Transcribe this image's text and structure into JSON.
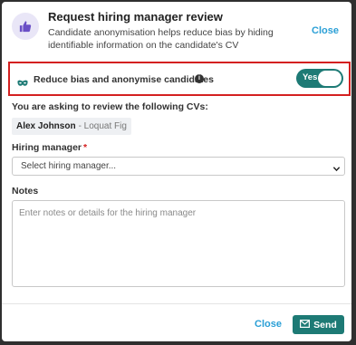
{
  "header": {
    "title": "Request hiring manager review",
    "subtitle": "Candidate anonymisation helps reduce bias by hiding identifiable information on the candidate's CV",
    "close_label": "Close",
    "icon": "thumbs-up-icon"
  },
  "anonymise": {
    "label": "Reduce bias and anonymise candidates",
    "info_glyph": "i",
    "toggle_label": "Yes",
    "toggle_on": true,
    "icon": "mask-icon"
  },
  "review": {
    "intro": "You are asking to review the following CVs:",
    "cvs": [
      {
        "name": "Alex Johnson",
        "company": "- Loquat Fig"
      }
    ]
  },
  "hiring_manager": {
    "label": "Hiring manager",
    "required_mark": "*",
    "placeholder": "Select hiring manager..."
  },
  "notes": {
    "label": "Notes",
    "placeholder": "Enter notes or details for the hiring manager"
  },
  "footer": {
    "close_label": "Close",
    "send_label": "Send",
    "send_icon": "envelope-icon"
  },
  "colors": {
    "accent": "#1d7a75",
    "link": "#2a9fd6",
    "highlight_border": "#d42020",
    "icon_circle": "#e9e6f7"
  }
}
